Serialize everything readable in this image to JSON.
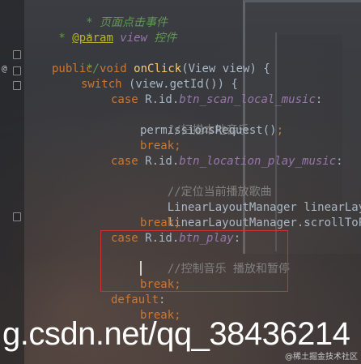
{
  "code": {
    "line1": {
      "text": " * 页面点击事件"
    },
    "line2": {
      "text": " *"
    },
    "line3": {
      "prefix": " * ",
      "annotation": "@param",
      "param_name": " view",
      "desc": " 控件"
    },
    "line4": {
      "text": " */"
    },
    "line5": {
      "kw1": "public",
      "kw2": "void",
      "method": "onClick",
      "rest": "(View view) {"
    },
    "line6": {
      "kw": "switch",
      "rest": " (view.getId()) {"
    },
    "line7": {
      "kw": "case",
      "prefix": " R.id.",
      "field": "btn_scan_local_music",
      "suffix": ":"
    },
    "line8": {
      "text": "//扫描本地音乐"
    },
    "line9": {
      "call": "permissionsRequest()",
      "semi": ";"
    },
    "line10": {
      "kw": "break",
      "semi": ";"
    },
    "line11": {
      "kw": "case",
      "prefix": " R.id.",
      "field": "btn_location_play_music",
      "suffix": ":"
    },
    "line12": {
      "text": "//定位当前播放歌曲"
    },
    "line13": {
      "text": "LinearLayoutManager linearLayou"
    },
    "line14": {
      "text": "linearLayoutManager.scrollToPos"
    },
    "line15": {
      "kw": "break",
      "semi": ";"
    },
    "line16": {
      "kw": "case",
      "prefix": " R.id.",
      "field": "btn_play",
      "suffix": ":"
    },
    "line17": {
      "text": "//控制音乐 播放和暂停"
    },
    "line19": {
      "kw": "break",
      "semi": ";"
    },
    "line20": {
      "kw": "default",
      "suffix": ":"
    },
    "line21": {
      "kw": "break",
      "semi": ";"
    }
  },
  "gutter": {
    "override_marker": "@"
  },
  "watermark": {
    "text": "g.csdn.net/qq_38436214"
  },
  "credit": {
    "text": "@稀土掘金技术社区"
  },
  "colors": {
    "keyword": "#cc7832",
    "method": "#ffc66d",
    "field": "#9876aa",
    "doc_comment": "#629755",
    "line_comment": "#808080",
    "plain": "#a9b7c6",
    "annotation": "#bbb529",
    "highlight_box": "#d32f2f"
  }
}
